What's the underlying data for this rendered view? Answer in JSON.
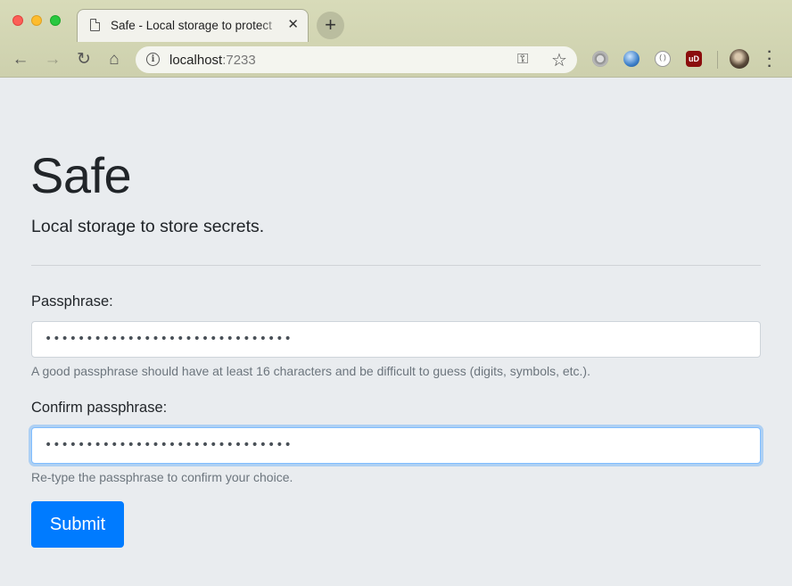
{
  "browser": {
    "tab_title": "Safe - Local storage to protect",
    "tab_close": "✕",
    "new_tab": "+",
    "url_host": "localhost",
    "url_port": ":7233",
    "extensions": [
      "gear-extension",
      "globe-extension",
      "circle-extension",
      "ublock-extension"
    ],
    "ublock_text": "uD"
  },
  "page": {
    "title": "Safe",
    "lead": "Local storage to store secrets.",
    "passphrase_label": "Passphrase:",
    "passphrase_value": "••••••••••••••••••••••••••••••",
    "passphrase_help": "A good passphrase should have at least 16 characters and be difficult to guess (digits, symbols, etc.).",
    "confirm_label": "Confirm passphrase:",
    "confirm_value": "••••••••••••••••••••••••••••••",
    "confirm_help": "Re-type the passphrase to confirm your choice.",
    "submit_label": "Submit"
  },
  "colors": {
    "primary": "#007bff",
    "page_background": "#e9ecef",
    "help_text": "#6c757d"
  }
}
